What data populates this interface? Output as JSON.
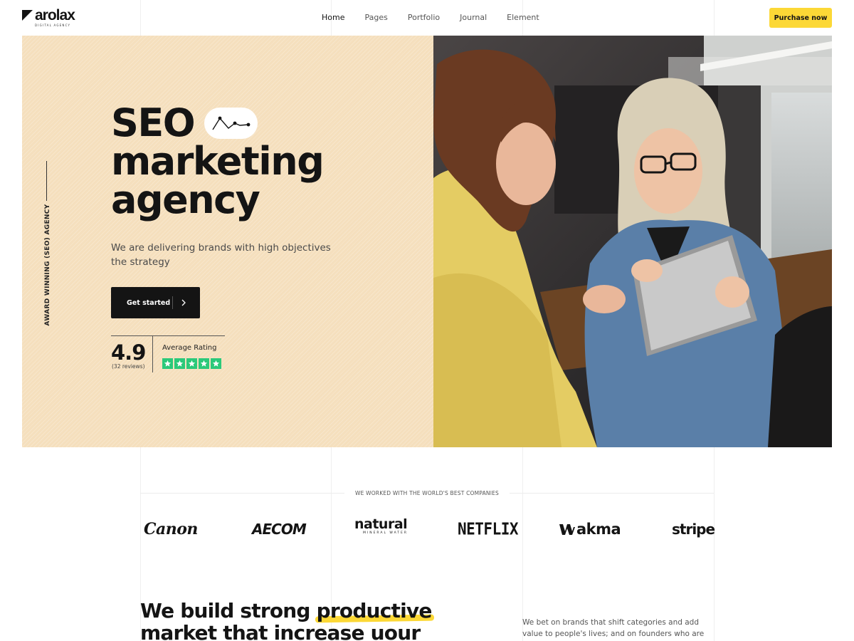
{
  "header": {
    "logo": {
      "name": "arolax",
      "tagline": "DIGITAL AGENCY"
    },
    "nav": [
      "Home",
      "Pages",
      "Portfolio",
      "Journal",
      "Element"
    ],
    "active_nav": "Home",
    "cta_label": "Purchase now"
  },
  "hero": {
    "side_label": "AWARD WINNING (SEO) AGENCY",
    "title_lines": [
      "SEO",
      "marketing",
      "agency"
    ],
    "subtitle": "We are delivering brands with high objectives the strategy",
    "button_label": "Get started",
    "rating": {
      "value": "4.9",
      "reviews": "(32 reviews)",
      "label": "Average Rating",
      "stars": 5
    },
    "photo_alt": "Two women smiling while looking at a tablet in an office"
  },
  "companies": {
    "label": "WE WORKED WITH THE WORLD'S BEST COMPANIES",
    "logos": [
      "Canon",
      "AECOM",
      "natural",
      "NETFLIX",
      "akma",
      "stripe"
    ],
    "natural_sub": "MINERAL WATER"
  },
  "about": {
    "heading_part1": "We build strong",
    "heading_highlight": "productive",
    "heading_line2": "market that increase uour",
    "text": "We bet on brands that shift categories and add value to people's lives; and on founders who are motivated"
  },
  "colors": {
    "accent_yellow": "#fcd836",
    "hero_bg": "#f5dfbd",
    "dark": "#141414",
    "star_green": "#2bc97a"
  }
}
